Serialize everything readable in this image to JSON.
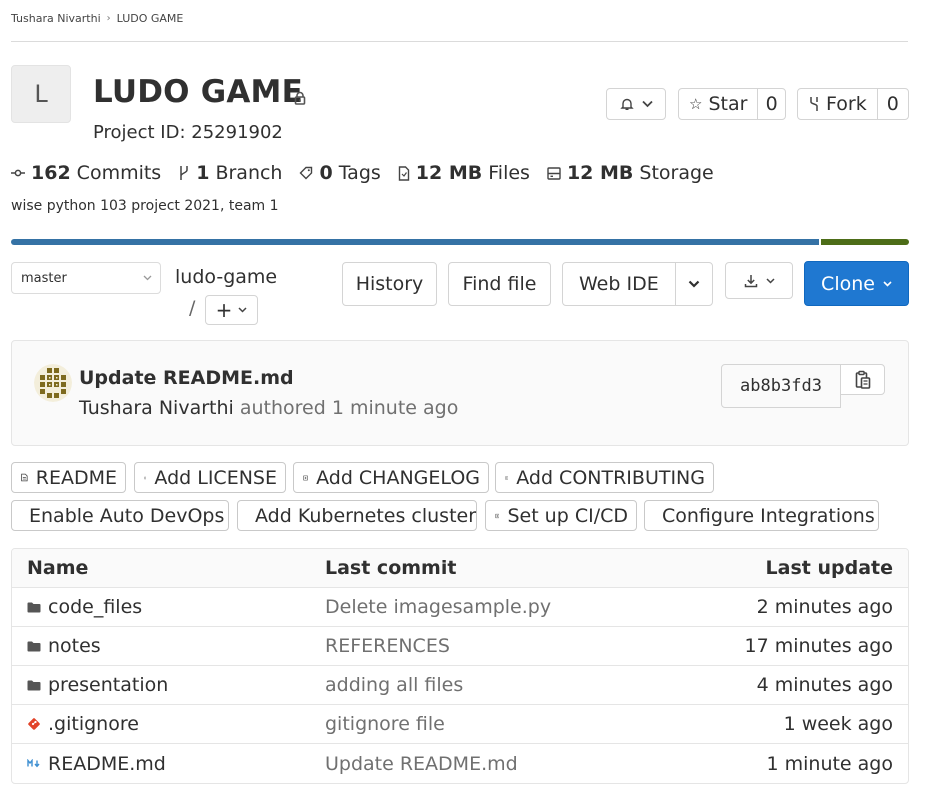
{
  "breadcrumb": {
    "owner": "Tushara Nivarthi",
    "project": "LUDO GAME"
  },
  "project": {
    "avatar_letter": "L",
    "title": "LUDO GAME",
    "id_label": "Project ID: 25291902",
    "description": "wise python 103 project 2021, team 1"
  },
  "actions": {
    "star_label": "Star",
    "star_count": "0",
    "fork_label": "Fork",
    "fork_count": "0"
  },
  "stats": {
    "commits_count": "162",
    "commits_label": "Commits",
    "branch_count": "1",
    "branch_label": "Branch",
    "tags_count": "0",
    "tags_label": "Tags",
    "files_size": "12 MB",
    "files_label": "Files",
    "storage_size": "12 MB",
    "storage_label": "Storage"
  },
  "languages": {
    "colors": [
      "#3572a5",
      "#4d6d18"
    ]
  },
  "repo": {
    "branch": "master",
    "path": "ludo-game",
    "path_sep": "/",
    "history_label": "History",
    "find_file_label": "Find file",
    "web_ide_label": "Web IDE",
    "clone_label": "Clone"
  },
  "last_commit": {
    "title": "Update README.md",
    "author": "Tushara Nivarthi",
    "meta": "authored 1 minute ago",
    "sha": "ab8b3fd3"
  },
  "quick_actions": [
    {
      "label": "README"
    },
    {
      "label": "Add LICENSE"
    },
    {
      "label": "Add CHANGELOG"
    },
    {
      "label": "Add CONTRIBUTING"
    },
    {
      "label": "Enable Auto DevOps"
    },
    {
      "label": "Add Kubernetes cluster"
    },
    {
      "label": "Set up CI/CD"
    },
    {
      "label": "Configure Integrations"
    }
  ],
  "files": {
    "headers": {
      "name": "Name",
      "last_commit": "Last commit",
      "last_update": "Last update"
    },
    "rows": [
      {
        "name": "code_files",
        "icon": "folder-icon",
        "commit": "Delete imagesample.py",
        "updated": "2 minutes ago"
      },
      {
        "name": "notes",
        "icon": "folder-icon",
        "commit": "REFERENCES",
        "updated": "17 minutes ago"
      },
      {
        "name": "presentation",
        "icon": "folder-icon",
        "commit": "adding all files",
        "updated": "4 minutes ago"
      },
      {
        "name": ".gitignore",
        "icon": "git-icon",
        "commit": "gitignore file",
        "updated": "1 week ago"
      },
      {
        "name": "README.md",
        "icon": "markdown-icon",
        "commit": "Update README.md",
        "updated": "1 minute ago"
      }
    ]
  },
  "colors": {
    "accent": "#1f78d1",
    "text": "#303030",
    "muted": "#707070"
  }
}
